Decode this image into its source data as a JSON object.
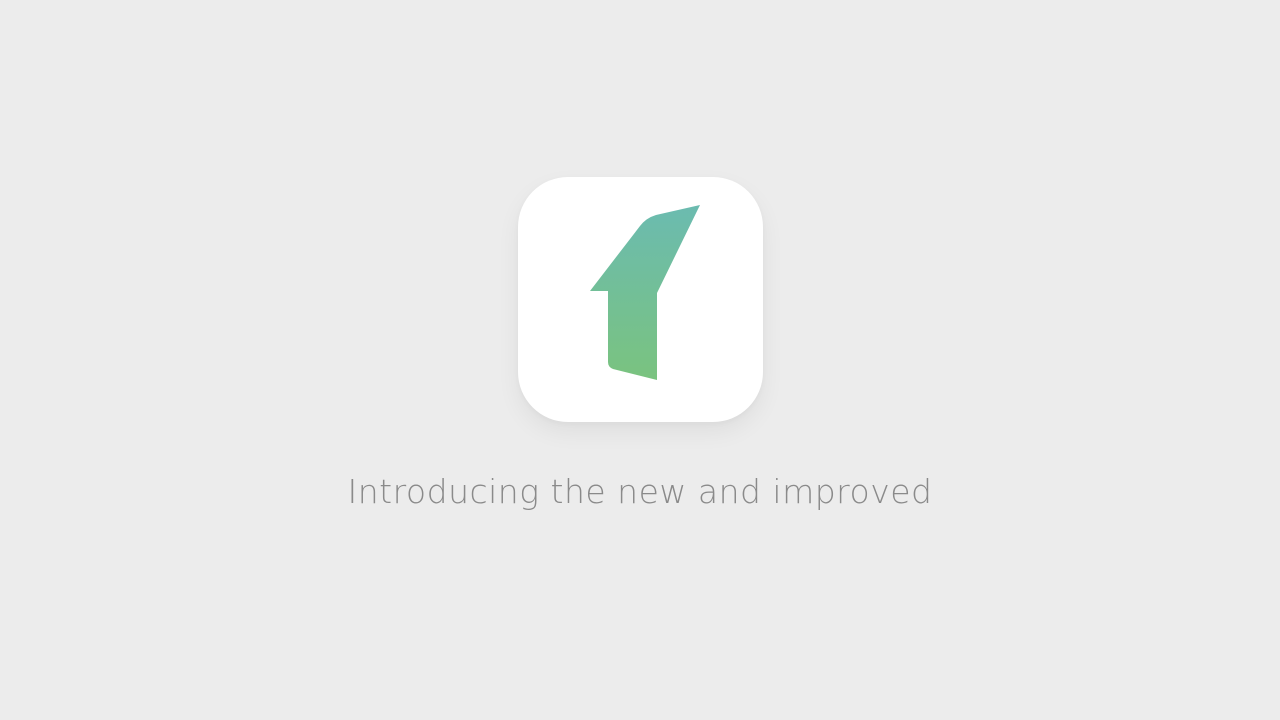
{
  "intro": {
    "tagline": "Introducing the new and improved",
    "logo_icon": "arrow-up-left-logo-icon"
  },
  "colors": {
    "background": "#ececec",
    "icon_tile": "#ffffff",
    "logo_gradient_top": "#6bbbb0",
    "logo_gradient_bottom": "#7ac37f",
    "tagline_text": "#8a8a8a"
  }
}
